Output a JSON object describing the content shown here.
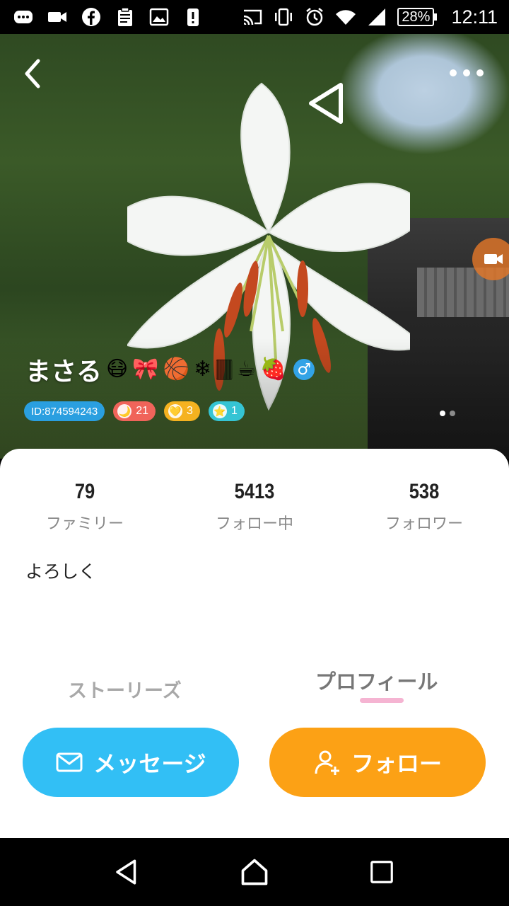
{
  "status_bar": {
    "time": "12:11",
    "battery": "28%",
    "icons": [
      "chat-icon",
      "video-call-icon",
      "facebook-icon",
      "clipboard-icon",
      "image-icon",
      "alert-icon",
      "cast-icon",
      "vibrate-icon",
      "alarm-icon",
      "wifi-icon",
      "signal-icon"
    ]
  },
  "profile": {
    "name": "まさる",
    "deco_emojis": [
      "😷",
      "🎀",
      "🏀",
      "❄",
      "🀫",
      "☕",
      "🍓"
    ],
    "gender": "♂",
    "id_badge": "ID:874594243",
    "moon_count": "21",
    "heart_count": "3",
    "star_count": "1",
    "bio": "よろしく"
  },
  "stats": [
    {
      "value": "79",
      "label": "ファミリー"
    },
    {
      "value": "5413",
      "label": "フォロー中"
    },
    {
      "value": "538",
      "label": "フォロワー"
    }
  ],
  "tabs": {
    "stories": "ストーリーズ",
    "profile": "プロフィール",
    "active": "profile"
  },
  "actions": {
    "message": "メッセージ",
    "follow": "フォロー"
  },
  "colors": {
    "message_button": "#32bff5",
    "follow_button": "#fca115",
    "tab_indicator": "#f5b4d2",
    "id_badge": "#2a9fe0",
    "moon_badge": "#f0645a",
    "heart_badge": "#f5b220",
    "star_badge": "#35c4d4"
  }
}
